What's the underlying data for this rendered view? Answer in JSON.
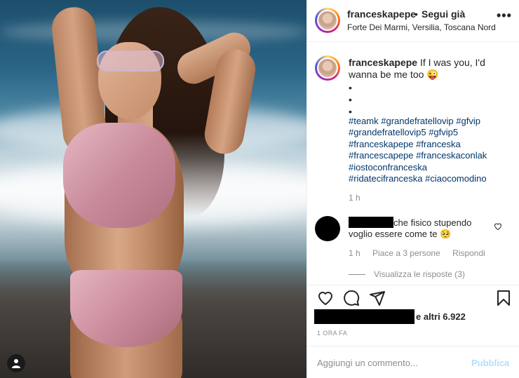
{
  "post": {
    "username": "franceskapepe",
    "follow_separator": "•",
    "follow_label": "Segui già",
    "location": "Forte Dei Marmi, Versilia, Toscana Nord",
    "more_label": "•••"
  },
  "caption": {
    "username": "franceskapepe",
    "text": "If I was you, I'd wanna be me too 😜",
    "bullets": [
      "•",
      "•",
      "•"
    ],
    "hashtags": [
      "#teamk",
      "#grandefratellovip",
      "#gfvip",
      "#grandefratellovip5",
      "#gfvip5",
      "#franceskapepe",
      "#franceska",
      "#francescapepe",
      "#franceskaconlak",
      "#iostoconfranceska",
      "#ridatecifranceska",
      "#ciaocomodino"
    ],
    "time": "1 h"
  },
  "comment": {
    "text_line1": "che fisico stupendo",
    "text_line2": "voglio essere come te 🥺",
    "time": "1 h",
    "likes": "Piace a 3 persone",
    "reply_label": "Rispondi",
    "view_replies": "Visualizza le risposte (3)"
  },
  "actions": {
    "icons": [
      "heart-icon",
      "comment-icon",
      "share-icon",
      "bookmark-icon"
    ]
  },
  "likes": {
    "text": "e altri 6.922"
  },
  "timestamp": "1 ORA FA",
  "add_comment": {
    "placeholder": "Aggiungi un commento...",
    "publish_label": "Pubblica"
  },
  "colors": {
    "link": "#00376b",
    "muted": "#8e8e8e",
    "publish_disabled": "#b2dffc",
    "text": "#262626"
  }
}
